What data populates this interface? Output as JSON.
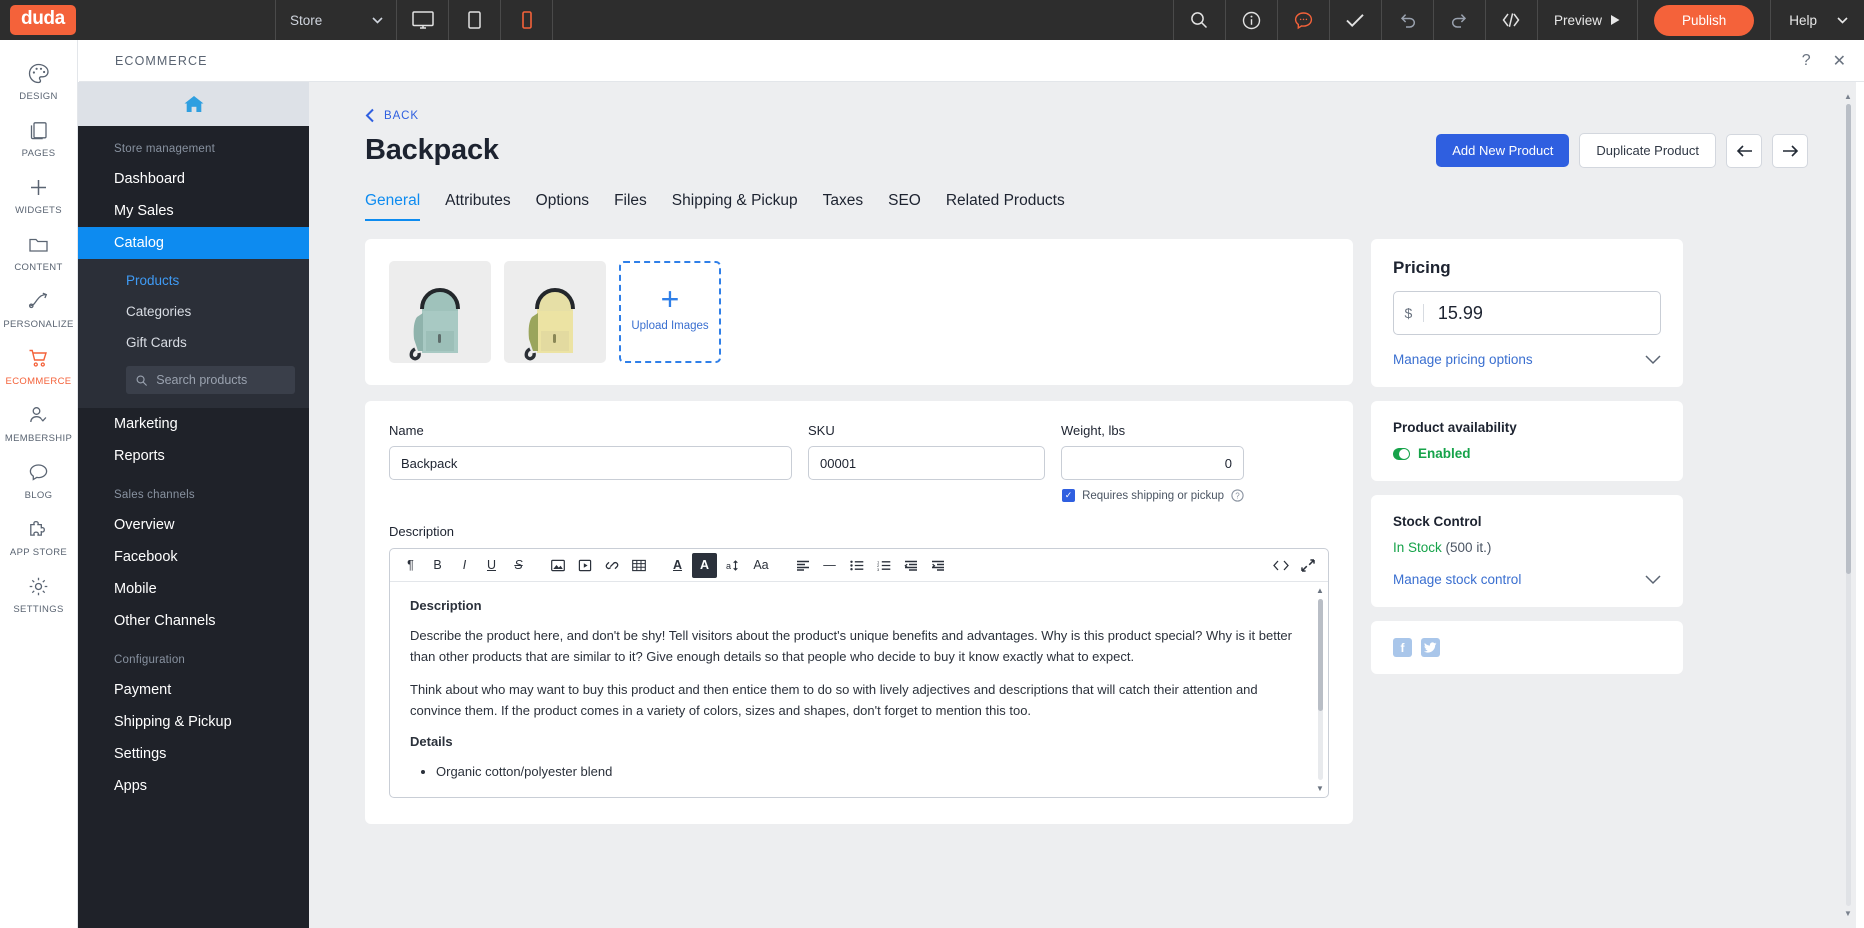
{
  "topbar": {
    "logo": "duda",
    "store_label": "Store",
    "devices": [
      {
        "name": "desktop-view-icon",
        "active": false
      },
      {
        "name": "tablet-view-icon",
        "active": false
      },
      {
        "name": "mobile-view-icon",
        "active": true
      }
    ],
    "icons": [
      {
        "name": "search-icon"
      },
      {
        "name": "info-icon"
      },
      {
        "name": "comment-icon"
      },
      {
        "name": "checkmark-icon"
      },
      {
        "name": "undo-icon"
      },
      {
        "name": "redo-icon"
      },
      {
        "name": "code-icon"
      }
    ],
    "preview_label": "Preview",
    "publish_label": "Publish",
    "help_label": "Help"
  },
  "rail": {
    "items": [
      {
        "label": "DESIGN",
        "icon": "palette-icon",
        "active": false
      },
      {
        "label": "PAGES",
        "icon": "pages-icon",
        "active": false
      },
      {
        "label": "WIDGETS",
        "icon": "plus-icon",
        "active": false
      },
      {
        "label": "CONTENT",
        "icon": "folder-icon",
        "active": false
      },
      {
        "label": "PERSONALIZE",
        "icon": "personalize-icon",
        "active": false
      },
      {
        "label": "ECOMMERCE",
        "icon": "cart-icon",
        "active": true
      },
      {
        "label": "MEMBERSHIP",
        "icon": "user-check-icon",
        "active": false
      },
      {
        "label": "BLOG",
        "icon": "chat-icon",
        "active": false
      },
      {
        "label": "APP STORE",
        "icon": "puzzle-icon",
        "active": false
      },
      {
        "label": "SETTINGS",
        "icon": "gear-icon",
        "active": false
      }
    ]
  },
  "panel": {
    "title": "ECOMMERCE",
    "help_icon": "question-icon",
    "close_icon": "close-icon"
  },
  "store_nav": {
    "home_icon": "home-icon",
    "section_store": "Store management",
    "items": [
      {
        "label": "Dashboard",
        "selected": false
      },
      {
        "label": "My Sales",
        "selected": false
      },
      {
        "label": "Catalog",
        "selected": true
      }
    ],
    "sub_items": [
      {
        "label": "Products",
        "current": true
      },
      {
        "label": "Categories",
        "current": false
      },
      {
        "label": "Gift Cards",
        "current": false
      }
    ],
    "search_placeholder": "Search products",
    "search_value": "",
    "items2": [
      {
        "label": "Marketing"
      },
      {
        "label": "Reports"
      }
    ],
    "section_channels": "Sales channels",
    "channels": [
      {
        "label": "Overview"
      },
      {
        "label": "Facebook"
      },
      {
        "label": "Mobile"
      },
      {
        "label": "Other Channels"
      }
    ],
    "section_config": "Configuration",
    "config": [
      {
        "label": "Payment"
      },
      {
        "label": "Shipping & Pickup"
      },
      {
        "label": "Settings"
      },
      {
        "label": "Apps"
      }
    ]
  },
  "product": {
    "back_label": "BACK",
    "title": "Backpack",
    "add_new_label": "Add New Product",
    "duplicate_label": "Duplicate Product",
    "prev_icon": "arrow-left-icon",
    "next_icon": "arrow-right-icon",
    "tabs": [
      {
        "label": "General",
        "active": true
      },
      {
        "label": "Attributes",
        "active": false
      },
      {
        "label": "Options",
        "active": false
      },
      {
        "label": "Files",
        "active": false
      },
      {
        "label": "Shipping & Pickup",
        "active": false
      },
      {
        "label": "Taxes",
        "active": false
      },
      {
        "label": "SEO",
        "active": false
      },
      {
        "label": "Related Products",
        "active": false
      }
    ],
    "images": [
      {
        "alt": "backpack-teal",
        "color": "#a8c9c3"
      },
      {
        "alt": "backpack-yellow",
        "color": "#e8dfa0"
      }
    ],
    "upload_label": "Upload Images",
    "fields": {
      "name_label": "Name",
      "name_value": "Backpack",
      "sku_label": "SKU",
      "sku_value": "00001",
      "weight_label": "Weight, lbs",
      "weight_value": "0",
      "shipping_checkbox_label": "Requires shipping or pickup",
      "shipping_checked": true,
      "help_icon": "question-icon"
    },
    "description_label": "Description",
    "editor_toolbar": [
      {
        "name": "paragraph-icon",
        "glyph": "¶"
      },
      {
        "name": "bold-icon",
        "glyph": "B"
      },
      {
        "name": "italic-icon",
        "glyph": "I"
      },
      {
        "name": "underline-icon",
        "glyph": "U"
      },
      {
        "name": "strikethrough-icon",
        "glyph": "S"
      },
      {
        "name": "image-icon",
        "glyph": ""
      },
      {
        "name": "video-icon",
        "glyph": ""
      },
      {
        "name": "link-icon",
        "glyph": ""
      },
      {
        "name": "table-icon",
        "glyph": ""
      },
      {
        "name": "text-color-icon",
        "glyph": "A"
      },
      {
        "name": "highlight-color-icon",
        "glyph": "A"
      },
      {
        "name": "font-size-icon",
        "glyph": "a"
      },
      {
        "name": "font-family-icon",
        "glyph": "Aa"
      },
      {
        "name": "align-icon",
        "glyph": ""
      },
      {
        "name": "horizontal-rule-icon",
        "glyph": "—"
      },
      {
        "name": "bullet-list-icon",
        "glyph": ""
      },
      {
        "name": "numbered-list-icon",
        "glyph": ""
      },
      {
        "name": "outdent-icon",
        "glyph": ""
      },
      {
        "name": "indent-icon",
        "glyph": ""
      }
    ],
    "editor_right": [
      {
        "name": "source-code-icon"
      },
      {
        "name": "fullscreen-icon"
      }
    ],
    "editor_content": {
      "heading": "Description",
      "paragraph1": "Describe the product here, and don't be shy! Tell visitors about the product's unique benefits and advantages. Why is this product special? Why is it better than other products that are similar to it? Give enough details so that people who decide to buy it know exactly what to expect.",
      "paragraph2": "Think about who may want to buy this product and then entice them to do so with lively adjectives and descriptions that will catch their attention and convince them. If the product comes in a variety of colors, sizes and shapes, don't forget to mention this too.",
      "details_heading": "Details",
      "bullet1": "Organic cotton/polyester blend"
    }
  },
  "sidebar_right": {
    "pricing_title": "Pricing",
    "currency": "$",
    "price": "15.99",
    "manage_pricing_label": "Manage pricing options",
    "availability_title": "Product availability",
    "availability_status": "Enabled",
    "stock_title": "Stock Control",
    "stock_status": "In Stock",
    "stock_count": "(500 it.)",
    "manage_stock_label": "Manage stock control",
    "social": [
      {
        "name": "facebook-icon",
        "glyph": "f"
      },
      {
        "name": "twitter-icon",
        "glyph": "t"
      }
    ]
  },
  "colors": {
    "brand_orange": "#f4623a",
    "accent_blue": "#0d8bf0",
    "primary_blue": "#2f5fe0",
    "success_green": "#16a34a",
    "dark_nav": "#1f2229"
  }
}
